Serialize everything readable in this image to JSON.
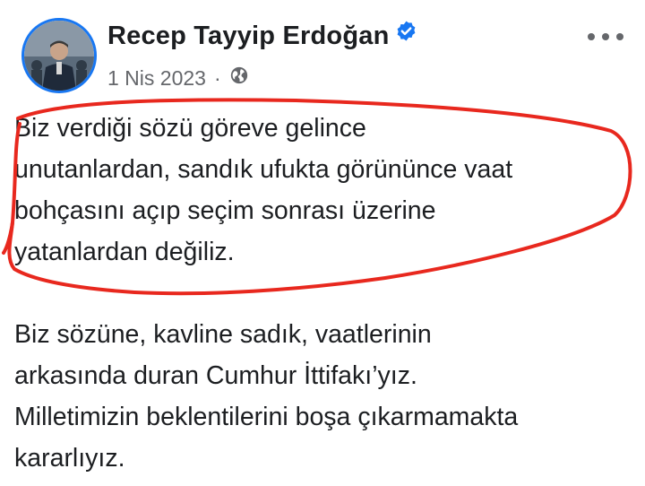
{
  "post": {
    "author": "Recep Tayyip Erdoğan",
    "date": "1 Nis 2023",
    "separator": "·",
    "audience_icon": "globe-icon",
    "verified_icon": "verified-badge-icon",
    "more_icon": "more-options-icon",
    "paragraph_1_lines": [
      "Biz verdiği sözü göreve gelince",
      "unutanlardan, sandık ufukta görününce vaat",
      "bohçasını açıp seçim sonrası üzerine",
      "yatanlardan değiliz."
    ],
    "paragraph_2_lines": [
      "Biz sözüne, kavline sadık, vaatlerinin",
      "arkasında duran Cumhur İttifakı’yız.",
      "Milletimizin beklentilerini boşa çıkarmamakta",
      "kararlıyız."
    ]
  },
  "colors": {
    "verified": "#1877f2",
    "annotation": "#e8281e",
    "meta": "#65676b",
    "text": "#1c1e21"
  }
}
